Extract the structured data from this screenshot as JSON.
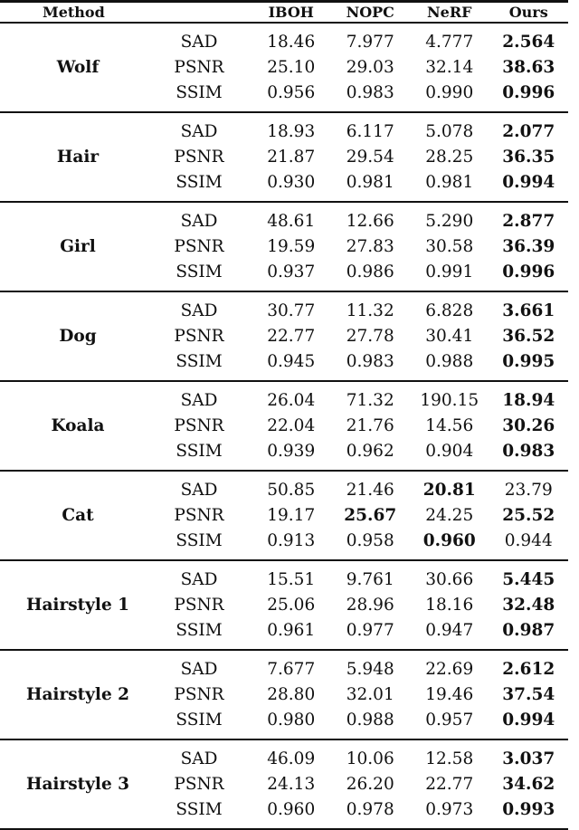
{
  "table": {
    "columns": [
      "Method",
      "",
      "IBOH",
      "NOPC",
      "NeRF",
      "Ours"
    ],
    "metrics": [
      "SAD",
      "PSNR",
      "SSIM"
    ],
    "groups": [
      {
        "name": "Wolf",
        "rows": [
          {
            "metric": "SAD",
            "values": [
              "18.46",
              "7.977",
              "4.777",
              "2.564"
            ],
            "bold": [
              false,
              false,
              false,
              true
            ]
          },
          {
            "metric": "PSNR",
            "values": [
              "25.10",
              "29.03",
              "32.14",
              "38.63"
            ],
            "bold": [
              false,
              false,
              false,
              true
            ]
          },
          {
            "metric": "SSIM",
            "values": [
              "0.956",
              "0.983",
              "0.990",
              "0.996"
            ],
            "bold": [
              false,
              false,
              false,
              true
            ]
          }
        ]
      },
      {
        "name": "Hair",
        "rows": [
          {
            "metric": "SAD",
            "values": [
              "18.93",
              "6.117",
              "5.078",
              "2.077"
            ],
            "bold": [
              false,
              false,
              false,
              true
            ]
          },
          {
            "metric": "PSNR",
            "values": [
              "21.87",
              "29.54",
              "28.25",
              "36.35"
            ],
            "bold": [
              false,
              false,
              false,
              true
            ]
          },
          {
            "metric": "SSIM",
            "values": [
              "0.930",
              "0.981",
              "0.981",
              "0.994"
            ],
            "bold": [
              false,
              false,
              false,
              true
            ]
          }
        ]
      },
      {
        "name": "Girl",
        "rows": [
          {
            "metric": "SAD",
            "values": [
              "48.61",
              "12.66",
              "5.290",
              "2.877"
            ],
            "bold": [
              false,
              false,
              false,
              true
            ]
          },
          {
            "metric": "PSNR",
            "values": [
              "19.59",
              "27.83",
              "30.58",
              "36.39"
            ],
            "bold": [
              false,
              false,
              false,
              true
            ]
          },
          {
            "metric": "SSIM",
            "values": [
              "0.937",
              "0.986",
              "0.991",
              "0.996"
            ],
            "bold": [
              false,
              false,
              false,
              true
            ]
          }
        ]
      },
      {
        "name": "Dog",
        "rows": [
          {
            "metric": "SAD",
            "values": [
              "30.77",
              "11.32",
              "6.828",
              "3.661"
            ],
            "bold": [
              false,
              false,
              false,
              true
            ]
          },
          {
            "metric": "PSNR",
            "values": [
              "22.77",
              "27.78",
              "30.41",
              "36.52"
            ],
            "bold": [
              false,
              false,
              false,
              true
            ]
          },
          {
            "metric": "SSIM",
            "values": [
              "0.945",
              "0.983",
              "0.988",
              "0.995"
            ],
            "bold": [
              false,
              false,
              false,
              true
            ]
          }
        ]
      },
      {
        "name": "Koala",
        "rows": [
          {
            "metric": "SAD",
            "values": [
              "26.04",
              "71.32",
              "190.15",
              "18.94"
            ],
            "bold": [
              false,
              false,
              false,
              true
            ]
          },
          {
            "metric": "PSNR",
            "values": [
              "22.04",
              "21.76",
              "14.56",
              "30.26"
            ],
            "bold": [
              false,
              false,
              false,
              true
            ]
          },
          {
            "metric": "SSIM",
            "values": [
              "0.939",
              "0.962",
              "0.904",
              "0.983"
            ],
            "bold": [
              false,
              false,
              false,
              true
            ]
          }
        ]
      },
      {
        "name": "Cat",
        "rows": [
          {
            "metric": "SAD",
            "values": [
              "50.85",
              "21.46",
              "20.81",
              "23.79"
            ],
            "bold": [
              false,
              false,
              true,
              false
            ]
          },
          {
            "metric": "PSNR",
            "values": [
              "19.17",
              "25.67",
              "24.25",
              "25.52"
            ],
            "bold": [
              false,
              true,
              false,
              true
            ]
          },
          {
            "metric": "SSIM",
            "values": [
              "0.913",
              "0.958",
              "0.960",
              "0.944"
            ],
            "bold": [
              false,
              false,
              true,
              false
            ]
          }
        ]
      },
      {
        "name": "Hairstyle 1",
        "rows": [
          {
            "metric": "SAD",
            "values": [
              "15.51",
              "9.761",
              "30.66",
              "5.445"
            ],
            "bold": [
              false,
              false,
              false,
              true
            ]
          },
          {
            "metric": "PSNR",
            "values": [
              "25.06",
              "28.96",
              "18.16",
              "32.48"
            ],
            "bold": [
              false,
              false,
              false,
              true
            ]
          },
          {
            "metric": "SSIM",
            "values": [
              "0.961",
              "0.977",
              "0.947",
              "0.987"
            ],
            "bold": [
              false,
              false,
              false,
              true
            ]
          }
        ]
      },
      {
        "name": "Hairstyle 2",
        "rows": [
          {
            "metric": "SAD",
            "values": [
              "7.677",
              "5.948",
              "22.69",
              "2.612"
            ],
            "bold": [
              false,
              false,
              false,
              true
            ]
          },
          {
            "metric": "PSNR",
            "values": [
              "28.80",
              "32.01",
              "19.46",
              "37.54"
            ],
            "bold": [
              false,
              false,
              false,
              true
            ]
          },
          {
            "metric": "SSIM",
            "values": [
              "0.980",
              "0.988",
              "0.957",
              "0.994"
            ],
            "bold": [
              false,
              false,
              false,
              true
            ]
          }
        ]
      },
      {
        "name": "Hairstyle 3",
        "rows": [
          {
            "metric": "SAD",
            "values": [
              "46.09",
              "10.06",
              "12.58",
              "3.037"
            ],
            "bold": [
              false,
              false,
              false,
              true
            ]
          },
          {
            "metric": "PSNR",
            "values": [
              "24.13",
              "26.20",
              "22.77",
              "34.62"
            ],
            "bold": [
              false,
              false,
              false,
              true
            ]
          },
          {
            "metric": "SSIM",
            "values": [
              "0.960",
              "0.978",
              "0.973",
              "0.993"
            ],
            "bold": [
              false,
              false,
              false,
              true
            ]
          }
        ]
      }
    ]
  }
}
